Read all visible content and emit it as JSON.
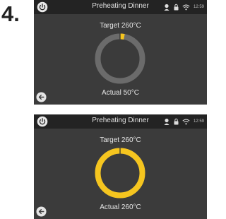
{
  "step": {
    "number": "4."
  },
  "screens": [
    {
      "title": "Preheating Dinner",
      "time": "12:59",
      "target_text": "Target 260°C",
      "actual_text": "Actual 50°C",
      "progress": 0.03,
      "target_marker": true,
      "colors": {
        "ring_fill": "#f5c51f",
        "ring_track": "#6b6b6b"
      },
      "icons": [
        "power-icon",
        "chef-icon",
        "lock-icon",
        "wifi-icon",
        "back-arrow-icon"
      ]
    },
    {
      "title": "Preheating Dinner",
      "time": "12:59",
      "target_text": "Target 260°C",
      "actual_text": "Actual 260°C",
      "progress": 1.0,
      "target_marker": true,
      "colors": {
        "ring_fill": "#f5c51f",
        "ring_track": "#6b6b6b"
      },
      "icons": [
        "power-icon",
        "chef-icon",
        "lock-icon",
        "wifi-icon",
        "back-arrow-icon"
      ]
    }
  ]
}
